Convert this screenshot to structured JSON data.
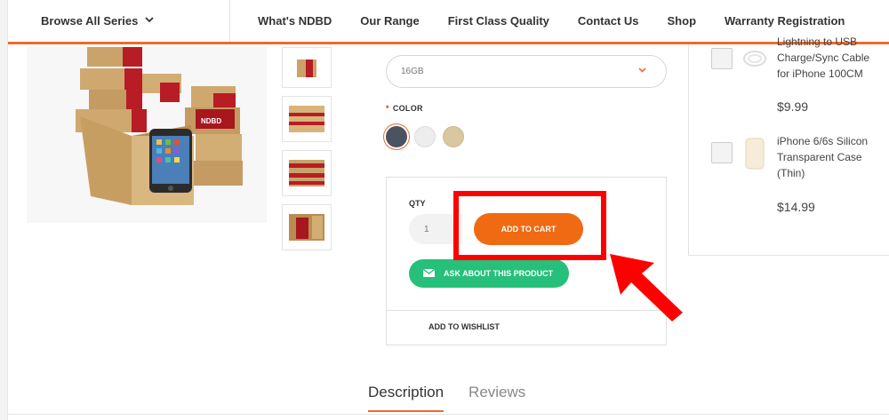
{
  "header": {
    "browse_label": "Browse All Series",
    "nav": [
      "What's NDBD",
      "Our Range",
      "First Class Quality",
      "Contact Us",
      "Shop",
      "Warranty Registration"
    ]
  },
  "product": {
    "storage_selected": "16GB",
    "color_label": "COLOR",
    "required_mark": "*",
    "colors": [
      "#4a5360",
      "#ededed",
      "#d8c79f"
    ],
    "qty_label": "QTY",
    "qty_value": "1",
    "add_to_cart": "ADD TO CART",
    "ask_about": "ASK ABOUT THIS PRODUCT",
    "add_to_wishlist": "ADD TO WISHLIST",
    "main_image_logo": "NDBD"
  },
  "related": [
    {
      "name": "Lightning to USB Charge/Sync Cable for iPhone 100CM",
      "price": "$9.99"
    },
    {
      "name": "iPhone 6/6s Silicon Transparent Case (Thin)",
      "price": "$14.99"
    }
  ],
  "tabs": [
    "Description",
    "Reviews"
  ],
  "colors": {
    "accent": "#ef6a2b",
    "ask_green": "#26c07a",
    "highlight": "#ff0000"
  }
}
